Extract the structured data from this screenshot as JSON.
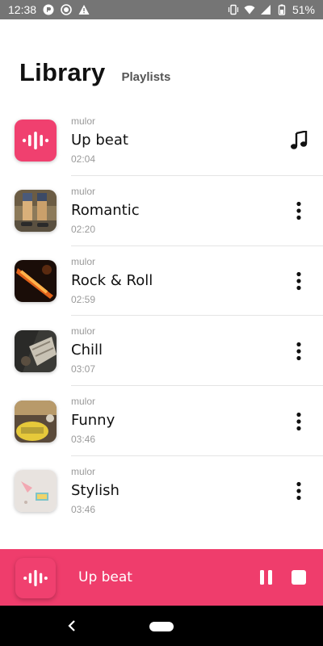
{
  "status_bar": {
    "time": "12:38",
    "battery": "51%"
  },
  "header": {
    "title": "Library",
    "tab_label": "Playlists"
  },
  "playlists": [
    {
      "artist": "mulor",
      "name": "Up beat",
      "duration": "02:04",
      "thumb": "brand-logo",
      "action_icon": "music-note-icon"
    },
    {
      "artist": "mulor",
      "name": "Romantic",
      "duration": "02:20",
      "thumb": "photo",
      "action_icon": "more-vert-icon"
    },
    {
      "artist": "mulor",
      "name": "Rock & Roll",
      "duration": "02:59",
      "thumb": "photo",
      "action_icon": "more-vert-icon"
    },
    {
      "artist": "mulor",
      "name": "Chill",
      "duration": "03:07",
      "thumb": "photo",
      "action_icon": "more-vert-icon"
    },
    {
      "artist": "mulor",
      "name": "Funny",
      "duration": "03:46",
      "thumb": "photo",
      "action_icon": "more-vert-icon"
    },
    {
      "artist": "mulor",
      "name": "Stylish",
      "duration": "03:46",
      "thumb": "photo",
      "action_icon": "more-vert-icon"
    }
  ],
  "player": {
    "now_playing": "Up beat",
    "pause_icon": "pause-icon",
    "stop_icon": "stop-icon"
  },
  "colors": {
    "accent": "#ef3d6c",
    "status_bar": "#757575"
  }
}
